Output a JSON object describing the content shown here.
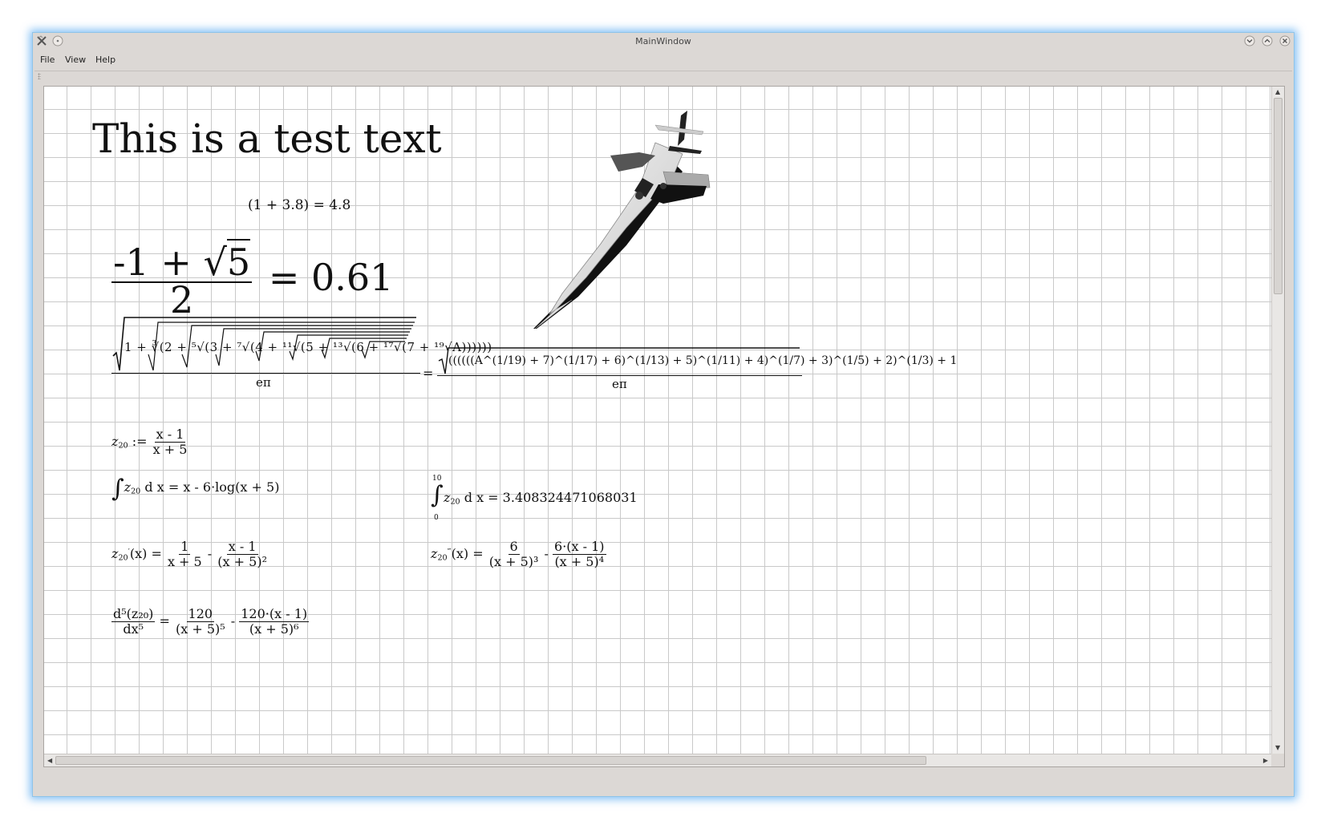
{
  "window": {
    "title": "MainWindow"
  },
  "menubar": {
    "items": [
      "File",
      "View",
      "Help"
    ]
  },
  "canvas": {
    "heading": "This is a test text",
    "eq_simple": "(1 + 3.8) = 4.8",
    "golden": {
      "num_left": "-1 + ",
      "num_radicand": "5",
      "den": "2",
      "rhs": "= 0.61"
    },
    "nested_radical_lhs": "1 + ∛(2 + ⁵√(3 + ⁷√(4 + ¹¹√(5 + ¹³√(6 + ¹⁷√(7 + ¹⁹√A))))))",
    "nested_radical_rhs": "((((((A^(1/19) + 7)^(1/17) + 6)^(1/13) + 5)^(1/11) + 4)^(1/7) + 3)^(1/5) + 2)^(1/3) + 1",
    "e_pi": "eπ",
    "equals": "=",
    "z20_def": {
      "lhs": "z",
      "sub": "20",
      "assign": " := ",
      "num": "x - 1",
      "den": "x + 5"
    },
    "integral_indef": {
      "body": "z",
      "sub": "20",
      "rest": " d x = x - 6·log(x + 5)"
    },
    "integral_def": {
      "upper": "10",
      "lower": "0",
      "body": "z",
      "sub": "20",
      "rest": " d x = 3.408324471068031"
    },
    "deriv1": {
      "lhs": "z",
      "sub": "20",
      "prime": "′",
      "arg": "(x) = ",
      "f1_num": "1",
      "f1_den": "x + 5",
      "minus": " - ",
      "f2_num": "x - 1",
      "f2_den": "(x + 5)²"
    },
    "deriv3": {
      "lhs": "z",
      "sub": "20",
      "prime": "‴",
      "arg": "(x) = ",
      "f1_num": "6",
      "f1_den": "(x + 5)³",
      "minus": " - ",
      "f2_num": "6·(x - 1)",
      "f2_den": "(x + 5)⁴"
    },
    "deriv5": {
      "lhs_num": "d⁵(z₂₀)",
      "lhs_den": "dx⁵",
      "eq": " = ",
      "f1_num": "120",
      "f1_den": "(x + 5)⁵",
      "minus": " - ",
      "f2_num": "120·(x - 1)",
      "f2_den": "(x + 5)⁶"
    },
    "image": "airplane-3d-render"
  },
  "colors": {
    "window_bg": "#dcd8d5",
    "glow": "#5aaaf0",
    "grid": "#c9c9c9"
  }
}
